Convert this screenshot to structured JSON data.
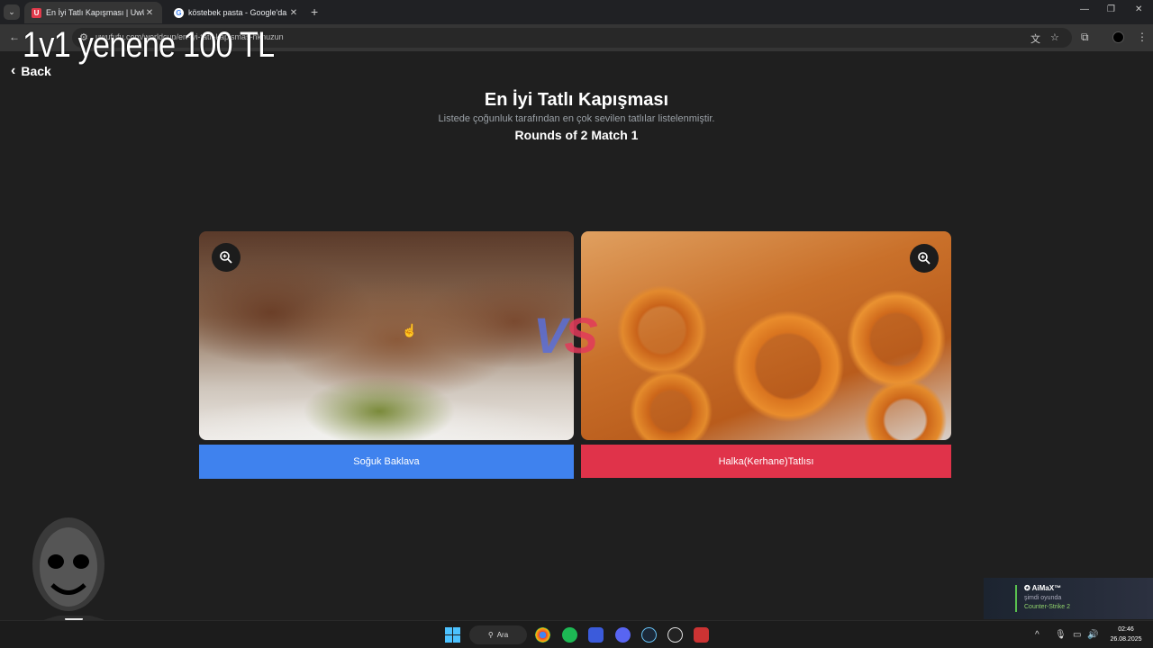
{
  "browser": {
    "tabs": [
      {
        "title": "En İyi Tatlı Kapışması | UwUFUFU",
        "favicon": "U",
        "active": true
      },
      {
        "title": "köstebek pasta - Google'da Ara",
        "favicon": "G",
        "active": false
      }
    ],
    "url": "uwufufu.com/worldcup/en-iyi-tatli-kapismas-hknuzun"
  },
  "overlay": {
    "title": "1v1 yenene 100 TL"
  },
  "page": {
    "back_label": "Back",
    "title": "En İyi Tatlı Kapışması",
    "subtitle": "Listede çoğunluk tarafından en çok sevilen tatlılar listelenmiştir.",
    "round": "Rounds of 2 Match 1",
    "vs_v": "V",
    "vs_s": "S",
    "left_choice": "Soğuk Baklava",
    "right_choice": "Halka(Kerhane)Tatlısı"
  },
  "notification": {
    "name": "AiMaX™",
    "status": "şimdi oyunda",
    "game": "Counter-Strike 2"
  },
  "taskbar": {
    "search_label": "Ara",
    "time": "02:46",
    "date": "26.08.2025"
  },
  "colors": {
    "left_button": "#3f82ee",
    "right_button": "#e0334a",
    "background": "#1f1f1f"
  }
}
